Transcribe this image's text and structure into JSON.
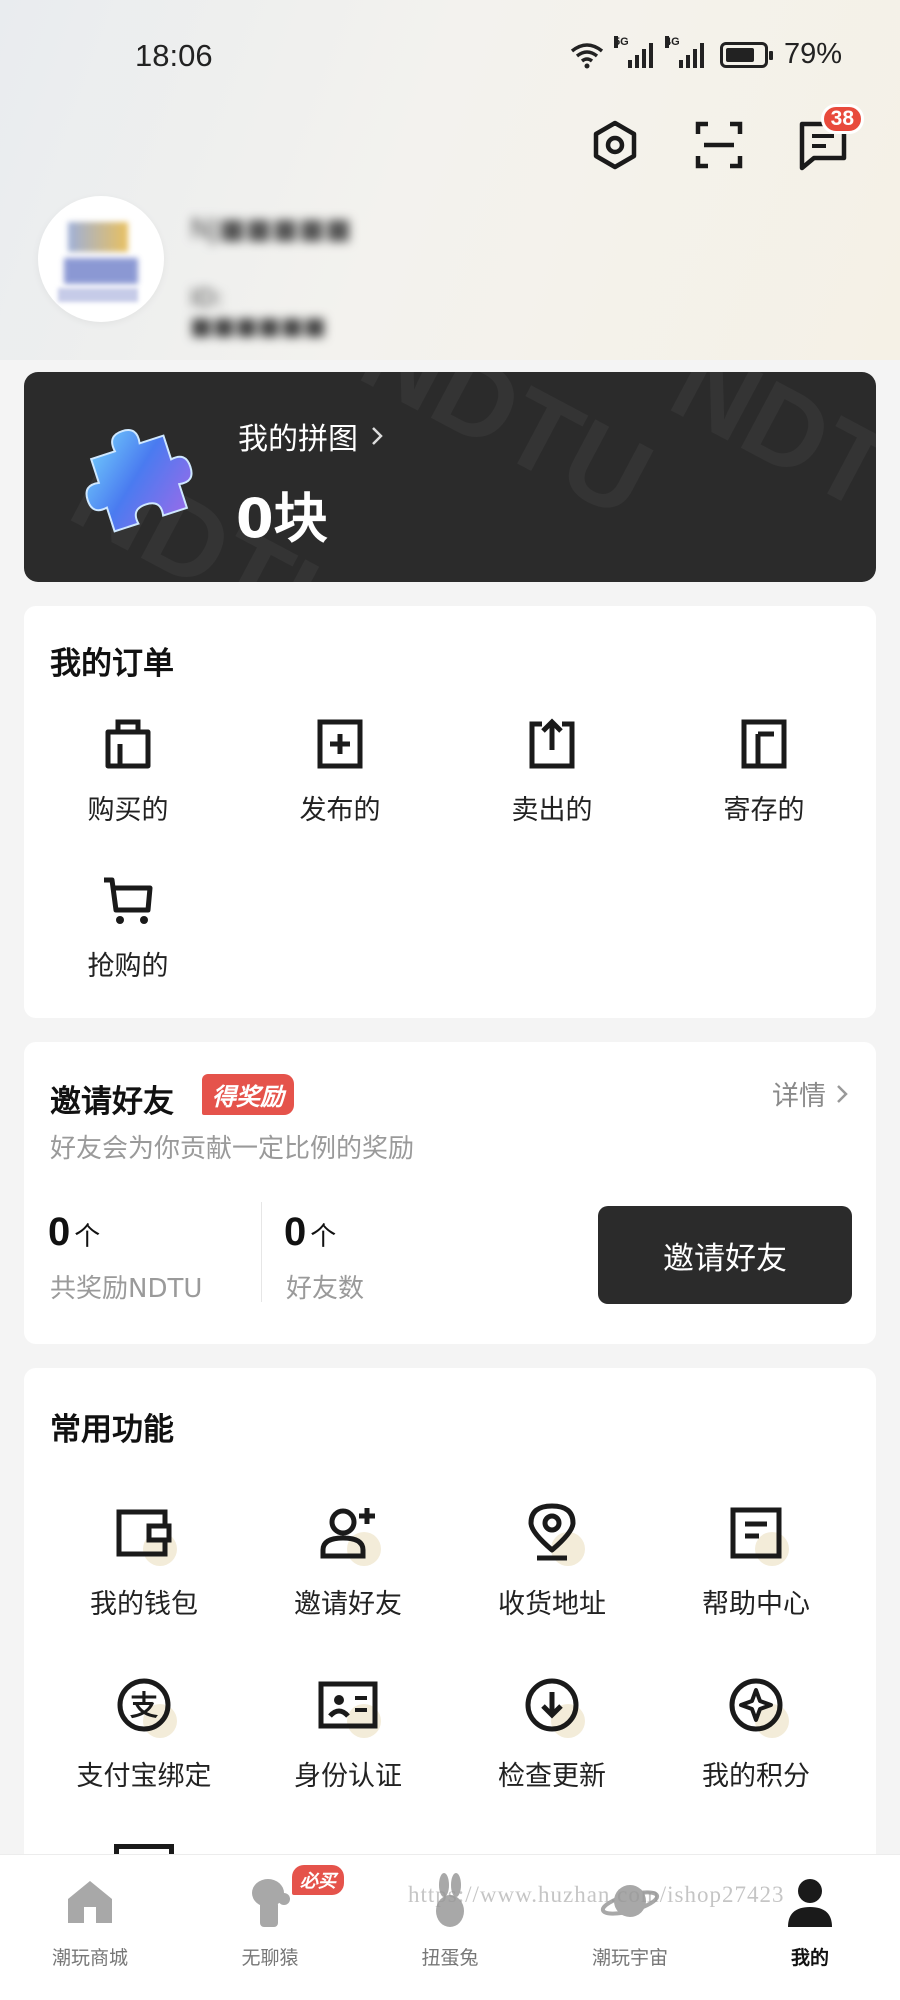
{
  "status_bar": {
    "time": "18:06",
    "network_1": "5G",
    "network_2": "4G",
    "battery_percent": "79%",
    "battery_level": 0.79
  },
  "header": {
    "message_badge": "38"
  },
  "profile": {
    "username_blurred": "NJ■■■■■",
    "user_id_blurred": "ID: ■■■■■■"
  },
  "puzzle": {
    "title": "我的拼图",
    "count": "0块",
    "watermark": "NDTU"
  },
  "orders": {
    "title": "我的订单",
    "items": [
      {
        "label": "购买的",
        "icon": "shopping-bag-icon"
      },
      {
        "label": "发布的",
        "icon": "publish-icon"
      },
      {
        "label": "卖出的",
        "icon": "sold-icon"
      },
      {
        "label": "寄存的",
        "icon": "storage-icon"
      },
      {
        "label": "抢购的",
        "icon": "cart-icon"
      }
    ]
  },
  "invite": {
    "title": "邀请好友",
    "tag": "得奖励",
    "detail": "详情",
    "subtitle": "好友会为你贡献一定比例的奖励",
    "reward_count": "0",
    "reward_unit": "个",
    "reward_label": "共奖励NDTU",
    "friends_count": "0",
    "friends_unit": "个",
    "friends_label": "好友数",
    "button": "邀请好友"
  },
  "functions": {
    "title": "常用功能",
    "items": [
      {
        "label": "我的钱包",
        "icon": "wallet-icon"
      },
      {
        "label": "邀请好友",
        "icon": "add-friend-icon"
      },
      {
        "label": "收货地址",
        "icon": "location-icon"
      },
      {
        "label": "帮助中心",
        "icon": "help-doc-icon"
      },
      {
        "label": "支付宝绑定",
        "icon": "alipay-icon"
      },
      {
        "label": "身份认证",
        "icon": "id-card-icon"
      },
      {
        "label": "检查更新",
        "icon": "update-icon"
      },
      {
        "label": "我的积分",
        "icon": "points-icon"
      }
    ]
  },
  "bottom_nav": {
    "must_buy": "必买",
    "items": [
      {
        "label": "潮玩商城",
        "icon": "home-icon"
      },
      {
        "label": "无聊猿",
        "icon": "ape-icon"
      },
      {
        "label": "扭蛋兔",
        "icon": "rabbit-icon"
      },
      {
        "label": "潮玩宇宙",
        "icon": "planet-icon"
      },
      {
        "label": "我的",
        "icon": "profile-icon"
      }
    ]
  },
  "watermark_url": "https://www.huzhan.com/ishop27423"
}
